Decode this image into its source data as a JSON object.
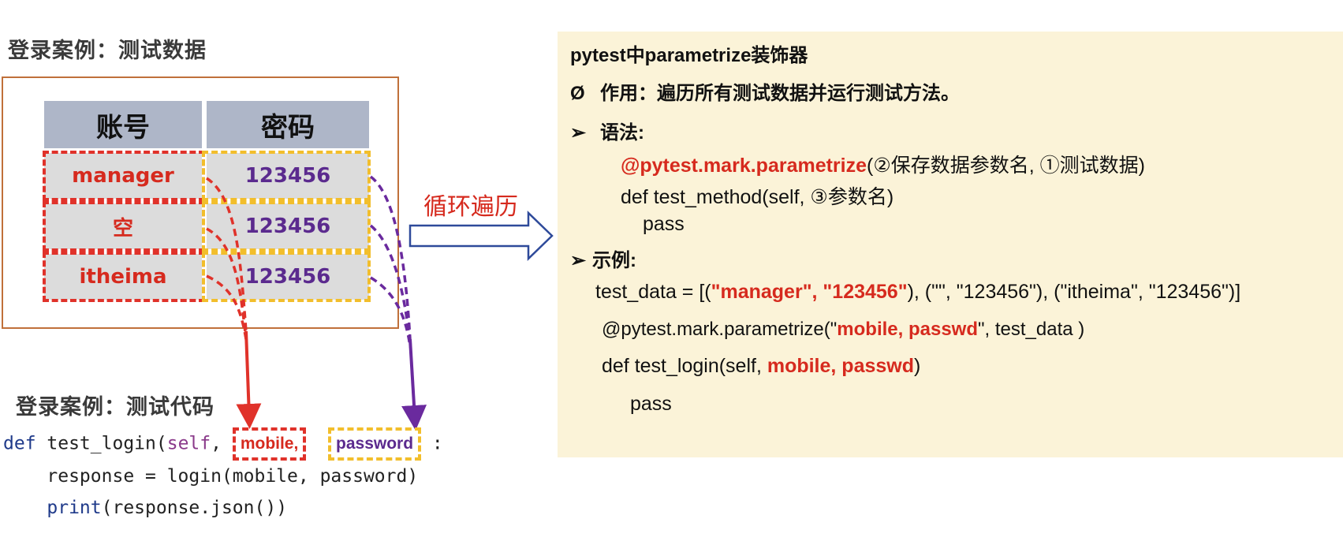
{
  "left": {
    "title_data": "登录案例：测试数据",
    "table": {
      "headers": [
        "账号",
        "密码"
      ],
      "rows": [
        {
          "account": "manager",
          "password": "123456"
        },
        {
          "account": "空",
          "password": "123456"
        },
        {
          "account": "itheima",
          "password": "123456"
        }
      ]
    },
    "title_code": "登录案例：测试代码",
    "code": {
      "line1_def": "def",
      "line1_func": " test_login(",
      "line1_self": "self",
      "line1_comma": ", ",
      "param_mobile": "mobile,",
      "param_password": "password",
      "line1_end": ":",
      "line2": "    response = login(mobile, password)",
      "line3_print": "print",
      "line3_rest": "(response.json())"
    }
  },
  "middle": {
    "loop_label": "循环遍历"
  },
  "panel": {
    "title": "pytest中parametrize装饰器",
    "purpose_bullet": "Ø",
    "purpose_text": "作用：遍历所有测试数据并运行测试方法。",
    "syntax_bullet": "➢",
    "syntax_label": "语法:",
    "syntax_decorator": "@pytest.mark.parametrize",
    "syntax_decorator_args": "(②保存数据参数名, ①测试数据)",
    "syntax_def": "def test_method(self, ③参数名)",
    "syntax_pass": "pass",
    "example_bullet": "➢",
    "example_label": "示例:",
    "ex_line1_a": "test_data = [(",
    "ex_line1_red": "\"manager\", \"123456\"",
    "ex_line1_b": "), (\"\", \"123456\"), (\"itheima\", \"123456\")]",
    "ex_line2_a": "@pytest.mark.parametrize(\"",
    "ex_line2_red": "mobile, passwd",
    "ex_line2_b": "\", test_data )",
    "ex_line3_a": "def test_login(self, ",
    "ex_line3_red": "mobile, passwd",
    "ex_line3_b": ")",
    "ex_line4": "pass"
  },
  "colors": {
    "red": "#d62a1e",
    "purple": "#5b2a8e",
    "yellow": "#f2be2c",
    "panel_bg": "#fbf3d8",
    "arrow_blue": "#1f3a8a"
  }
}
